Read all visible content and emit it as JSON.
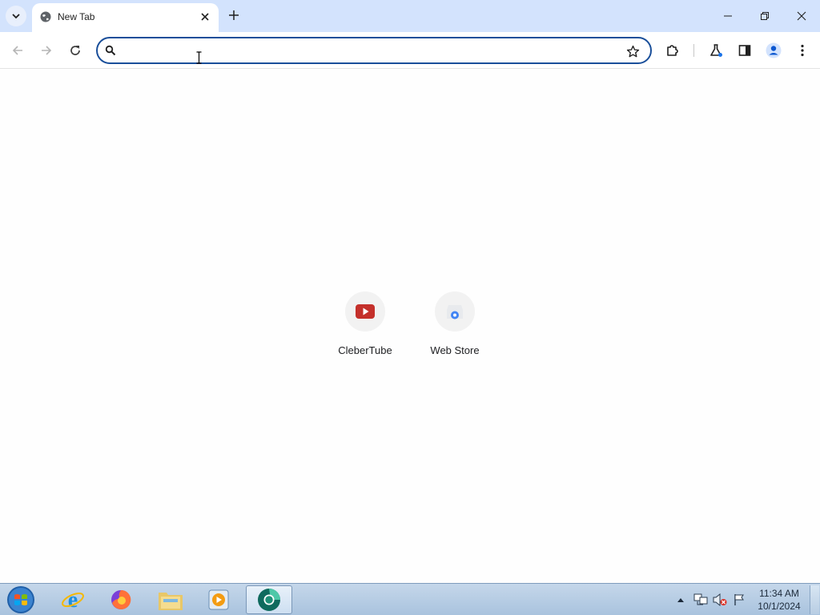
{
  "browser": {
    "tab": {
      "title": "New Tab"
    },
    "omnibox": {
      "value": "",
      "placeholder": ""
    }
  },
  "shortcuts": [
    {
      "label": "CleberTube",
      "icon": "video-play-icon",
      "color": "#c4302b"
    },
    {
      "label": "Web Store",
      "icon": "web-store-icon",
      "color": "#4285f4"
    }
  ],
  "taskbar": {
    "apps": [
      {
        "name": "internet-explorer-icon"
      },
      {
        "name": "firefox-icon"
      },
      {
        "name": "file-explorer-icon"
      },
      {
        "name": "media-player-icon"
      },
      {
        "name": "chrome-icon",
        "active": true
      }
    ],
    "clock": {
      "time": "11:34 AM",
      "date": "10/1/2024"
    }
  },
  "colors": {
    "tabstrip": "#d3e3fd",
    "omnibox_border": "#1a4f9a",
    "taskbar": "#b7cde4"
  }
}
